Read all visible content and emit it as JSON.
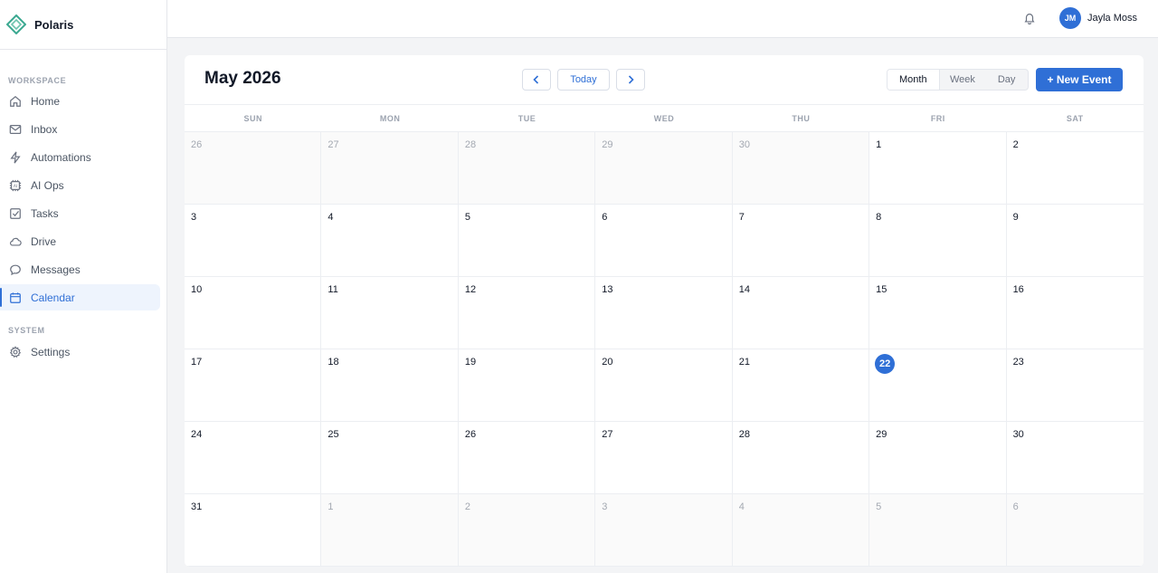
{
  "app": {
    "name": "Polaris"
  },
  "sidebar": {
    "sections": [
      {
        "label": "WORKSPACE",
        "items": [
          {
            "label": "Home",
            "icon": "home-icon"
          },
          {
            "label": "Inbox",
            "icon": "mail-icon"
          },
          {
            "label": "Automations",
            "icon": "bolt-icon"
          },
          {
            "label": "AI Ops",
            "icon": "ai-chip-icon"
          },
          {
            "label": "Tasks",
            "icon": "checkbox-icon"
          },
          {
            "label": "Drive",
            "icon": "cloud-icon"
          },
          {
            "label": "Messages",
            "icon": "chat-icon"
          },
          {
            "label": "Calendar",
            "icon": "calendar-icon",
            "active": true
          }
        ]
      },
      {
        "label": "SYSTEM",
        "items": [
          {
            "label": "Settings",
            "icon": "gear-icon"
          }
        ]
      }
    ]
  },
  "topbar": {
    "user": {
      "initials": "JM",
      "name": "Jayla Moss"
    }
  },
  "calendar": {
    "title": "May 2026",
    "today_label": "Today",
    "views": [
      "Month",
      "Week",
      "Day"
    ],
    "active_view": "Month",
    "new_event_label": "+ New Event",
    "weekdays": [
      "SUN",
      "MON",
      "TUE",
      "WED",
      "THU",
      "FRI",
      "SAT"
    ],
    "days": [
      {
        "day": "26",
        "muted": true
      },
      {
        "day": "27",
        "muted": true
      },
      {
        "day": "28",
        "muted": true
      },
      {
        "day": "29",
        "muted": true
      },
      {
        "day": "30",
        "muted": true
      },
      {
        "day": "1"
      },
      {
        "day": "2"
      },
      {
        "day": "3"
      },
      {
        "day": "4"
      },
      {
        "day": "5"
      },
      {
        "day": "6"
      },
      {
        "day": "7"
      },
      {
        "day": "8"
      },
      {
        "day": "9"
      },
      {
        "day": "10"
      },
      {
        "day": "11"
      },
      {
        "day": "12"
      },
      {
        "day": "13"
      },
      {
        "day": "14"
      },
      {
        "day": "15"
      },
      {
        "day": "16"
      },
      {
        "day": "17"
      },
      {
        "day": "18"
      },
      {
        "day": "19"
      },
      {
        "day": "20"
      },
      {
        "day": "21"
      },
      {
        "day": "22",
        "today": true
      },
      {
        "day": "23"
      },
      {
        "day": "24"
      },
      {
        "day": "25"
      },
      {
        "day": "26"
      },
      {
        "day": "27"
      },
      {
        "day": "28"
      },
      {
        "day": "29"
      },
      {
        "day": "30"
      },
      {
        "day": "31"
      },
      {
        "day": "1",
        "muted": true
      },
      {
        "day": "2",
        "muted": true
      },
      {
        "day": "3",
        "muted": true
      },
      {
        "day": "4",
        "muted": true
      },
      {
        "day": "5",
        "muted": true
      },
      {
        "day": "6",
        "muted": true
      }
    ]
  },
  "colors": {
    "accent": "#2f6fd6",
    "brand_logo": "#3aa890"
  }
}
